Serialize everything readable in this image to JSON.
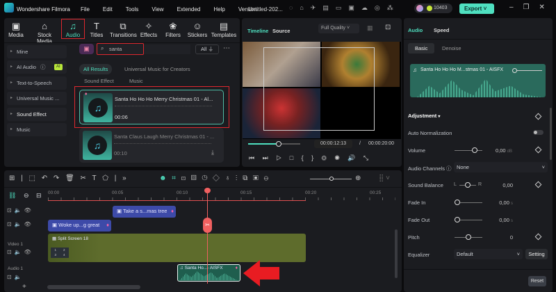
{
  "app": {
    "title": "Wondershare Filmora",
    "project": "Untitled-202...",
    "credits": "10403",
    "export": "Export"
  },
  "menu": [
    "File",
    "Edit",
    "Tools",
    "View",
    "Extended",
    "Help",
    "Version"
  ],
  "toolbar": [
    {
      "label": "Media",
      "icon": "▣"
    },
    {
      "label": "Stock Media",
      "icon": "⌂"
    },
    {
      "label": "Audio",
      "icon": "♫"
    },
    {
      "label": "Titles",
      "icon": "T"
    },
    {
      "label": "Transitions",
      "icon": "⧉"
    },
    {
      "label": "Effects",
      "icon": "✧"
    },
    {
      "label": "Filters",
      "icon": "❀"
    },
    {
      "label": "Stickers",
      "icon": "☺"
    },
    {
      "label": "Templates",
      "icon": "▤"
    }
  ],
  "sidebar": [
    "Mine",
    "AI Audio",
    "Text-to-Speech",
    "Universal Music ...",
    "Sound Effect",
    "Music"
  ],
  "ai_badge": "AI",
  "search": {
    "value": "santa",
    "filter": "All"
  },
  "filters": [
    "All Results",
    "Universal Music for Creators",
    "Sound Effect",
    "Music"
  ],
  "results": [
    {
      "title": "Santa Ho Ho Ho Merry Christmas 01 - Al...",
      "duration": "00:06"
    },
    {
      "title": "Santa Claus Laugh Merry Christmas 01 - ...",
      "duration": "00:10"
    }
  ],
  "preview": {
    "tabs": [
      "Timeline",
      "Source"
    ],
    "quality": "Full Quality",
    "current": "00:00:12:13",
    "sep": "/",
    "total": "00:00:20:00",
    "progress": 0.62
  },
  "right": {
    "tabs": [
      "Audio",
      "Speed"
    ],
    "subtabs": [
      "Basic",
      "Denoise"
    ],
    "clip": "Santa Ho Ho Ho M...stmas 01 - AISFX",
    "section": "Adjustment",
    "rows": [
      {
        "label": "Auto Normalization"
      },
      {
        "label": "Volume",
        "value": "0,00",
        "unit": "dB",
        "pos": 0.72
      },
      {
        "label": "Audio Channels",
        "select": "None"
      },
      {
        "label": "Sound Balance",
        "value": "0,00",
        "pos": 0.5,
        "l": "L",
        "r": "R"
      },
      {
        "label": "Fade In",
        "value": "0,00",
        "unit": "s",
        "pos": 0
      },
      {
        "label": "Fade Out",
        "value": "0,00",
        "unit": "s",
        "pos": 0
      },
      {
        "label": "Pitch",
        "value": "0",
        "pos": 0.5
      },
      {
        "label": "Equalizer",
        "select": "Default",
        "button": "Setting"
      }
    ],
    "reset": "Reset"
  },
  "timeline": {
    "ticks": [
      "00:00",
      "00:05",
      "00:10",
      "00:15",
      "00:20",
      "00:25"
    ],
    "tracks": [
      "Video 1",
      "Audio 1"
    ],
    "clips": {
      "title1": "Take a s...mas tree",
      "title2": "Woke up...g great",
      "video": "Split Screen 18",
      "audio": "Santa Ho...- AISFX"
    },
    "grid": [
      "1",
      "2",
      "3",
      "4"
    ],
    "playhead_seconds": 12.4
  },
  "colors": {
    "accent": "#4fe0c0",
    "highlight": "#e0282e",
    "title_clip": "#3d4aa8",
    "video_clip": "#5e6c2c",
    "audio_clip": "#1f5e4e"
  }
}
